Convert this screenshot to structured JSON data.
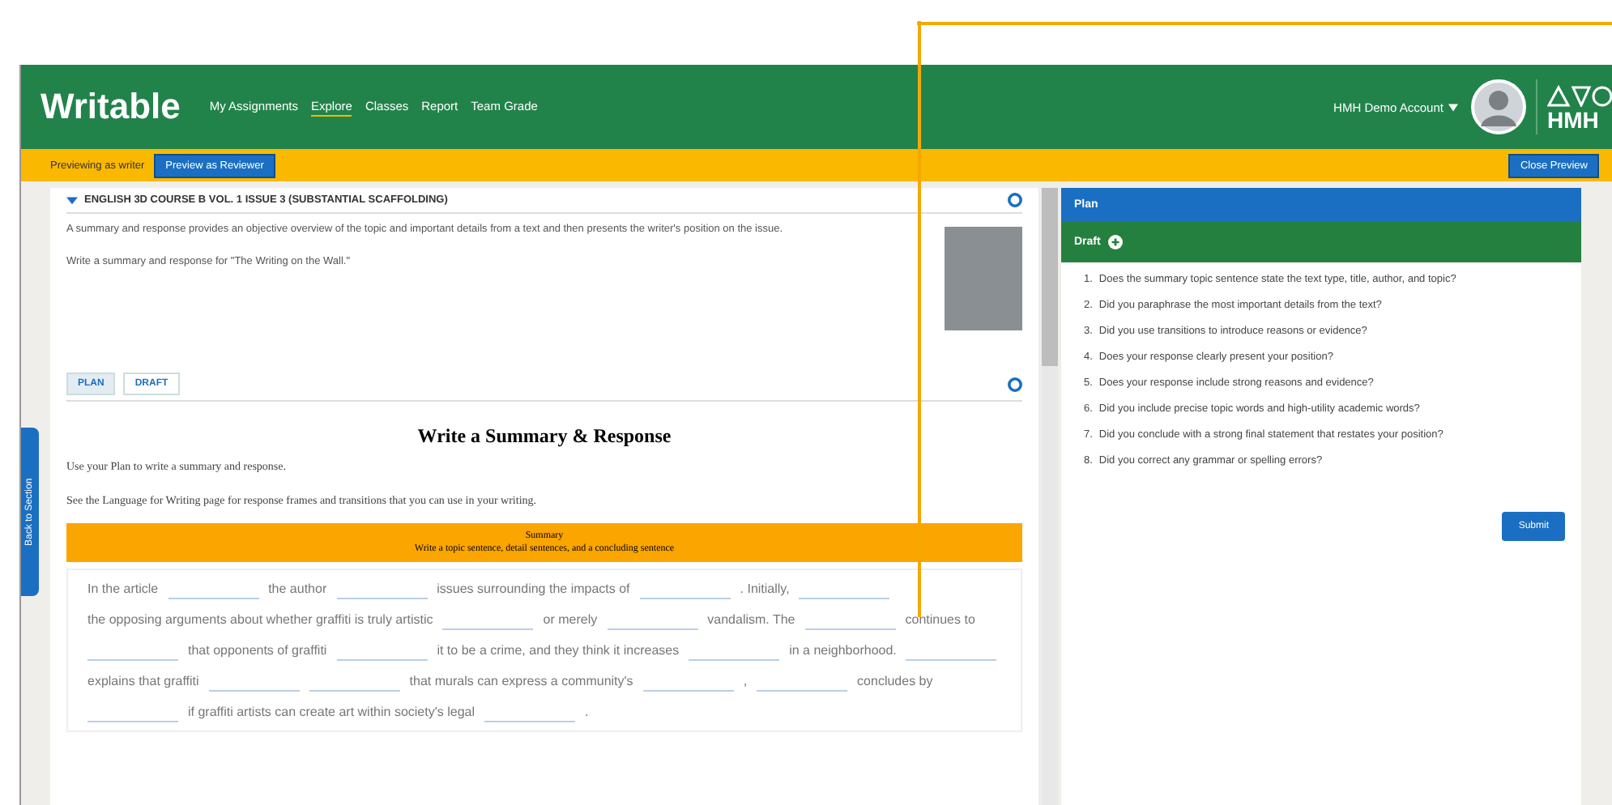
{
  "header": {
    "logo": "Writable",
    "nav": [
      {
        "label": "My Assignments",
        "selected": false
      },
      {
        "label": "Explore",
        "selected": true
      },
      {
        "label": "Classes",
        "selected": false
      },
      {
        "label": "Report",
        "selected": false
      },
      {
        "label": "Team Grade",
        "selected": false
      }
    ],
    "account": "HMH Demo Account",
    "brand": "HMH"
  },
  "preview_bar": {
    "label": "Previewing as writer",
    "switch_button": "Preview as Reviewer",
    "close_button": "Close Preview"
  },
  "side_tab": "Back to Section",
  "assignment": {
    "title": "ENGLISH 3D COURSE B VOL. 1 ISSUE 3 (SUBSTANTIAL SCAFFOLDING)",
    "expanded": true,
    "description": "A summary and response provides an objective overview of the topic and important details from a text and then presents the writer's position on the issue.",
    "prompt": "Write a summary and response for \"The Writing on the Wall.\""
  },
  "tabs": [
    {
      "label": "PLAN",
      "selected": true
    },
    {
      "label": "DRAFT",
      "selected": false
    }
  ],
  "draft": {
    "heading": "Write a Summary & Response",
    "instructions": [
      "Use your Plan to write a summary and response.",
      "See the Language for Writing page for response frames and transitions that you can use in your writing."
    ],
    "banner": {
      "title": "Summary",
      "subtitle": "Write a topic sentence, detail sentences, and a concluding sentence"
    },
    "frame": [
      {
        "kind": "text",
        "text": "In the article"
      },
      {
        "kind": "blank"
      },
      {
        "kind": "text",
        "text": "the author"
      },
      {
        "kind": "blank"
      },
      {
        "kind": "text",
        "text": "issues surrounding the impacts of"
      },
      {
        "kind": "blank"
      },
      {
        "kind": "text",
        "text": ". Initially,"
      },
      {
        "kind": "blank"
      },
      {
        "kind": "text",
        "text": "the opposing arguments about whether graffiti is truly artistic"
      },
      {
        "kind": "blank"
      },
      {
        "kind": "text",
        "text": "or merely"
      },
      {
        "kind": "blank"
      },
      {
        "kind": "text",
        "text": "vandalism. The"
      },
      {
        "kind": "blank"
      },
      {
        "kind": "text",
        "text": "continues to"
      },
      {
        "kind": "blank"
      },
      {
        "kind": "text",
        "text": "that opponents of graffiti"
      },
      {
        "kind": "blank"
      },
      {
        "kind": "text",
        "text": "it to be a crime, and they think it increases"
      },
      {
        "kind": "blank"
      },
      {
        "kind": "text",
        "text": "in a neighborhood."
      },
      {
        "kind": "blank"
      },
      {
        "kind": "text",
        "text": "explains that graffiti"
      },
      {
        "kind": "blank"
      },
      {
        "kind": "blank"
      },
      {
        "kind": "text",
        "text": "that murals can express a community's"
      },
      {
        "kind": "blank"
      },
      {
        "kind": "text",
        "text": ","
      },
      {
        "kind": "blank"
      },
      {
        "kind": "text",
        "text": "concludes by"
      },
      {
        "kind": "blank"
      },
      {
        "kind": "text",
        "text": "if graffiti artists can create art within society's legal"
      },
      {
        "kind": "blank"
      },
      {
        "kind": "text",
        "text": "."
      }
    ]
  },
  "checklist": {
    "plan_header": "Plan",
    "draft_header": "Draft",
    "questions": [
      {
        "number": "1.",
        "text": "Does the summary topic sentence state the text type, title, author, and topic?"
      },
      {
        "number": "2.",
        "text": "Did you paraphrase the most important details from the text?"
      },
      {
        "number": "3.",
        "text": "Did you use transitions to introduce reasons or evidence?"
      },
      {
        "number": "4.",
        "text": "Does your response clearly present your position?"
      },
      {
        "number": "5.",
        "text": "Does your response include strong reasons and evidence?"
      },
      {
        "number": "6.",
        "text": "Did you include precise topic words and high-utility academic words?"
      },
      {
        "number": "7.",
        "text": "Did you conclude with a strong final statement that restates your position?"
      },
      {
        "number": "8.",
        "text": "Did you correct any grammar or spelling errors?"
      }
    ],
    "submit": "Submit"
  }
}
